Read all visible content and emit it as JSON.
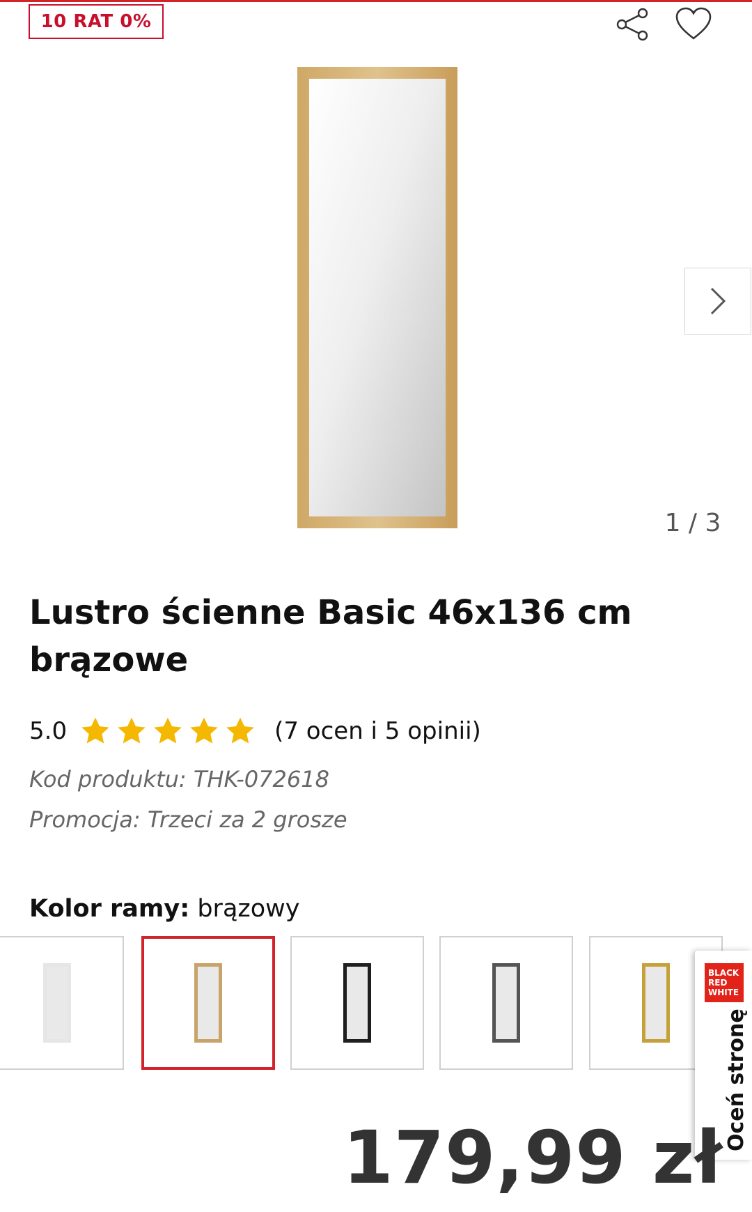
{
  "promo_badge": "10 RAT 0%",
  "icons": {
    "share": "share-icon",
    "favorite": "heart-icon",
    "next": "chevron-right-icon"
  },
  "gallery": {
    "current": "1",
    "separator": "/",
    "total": "3"
  },
  "product": {
    "title": "Lustro ścienne Basic 46x136 cm brązowe",
    "rating_value": "5.0",
    "rating_stars": 5,
    "rating_count": "(7 ocen i 5 opinii)",
    "code": "Kod produktu: THK-072618",
    "promotion": "Promocja: Trzeci za 2 grosze",
    "color_label": "Kolor ramy:",
    "color_value": "brązowy",
    "price": "179,99 zł"
  },
  "swatches": [
    {
      "name": "biały",
      "frame": "#e6e6e6",
      "selected": false
    },
    {
      "name": "brązowy",
      "frame": "#c9a46a",
      "selected": true
    },
    {
      "name": "czarny",
      "frame": "#1f1f1f",
      "selected": false
    },
    {
      "name": "szary",
      "frame": "#555555",
      "selected": false
    },
    {
      "name": "złoty",
      "frame": "#c6a13a",
      "selected": false
    }
  ],
  "feedback_tab": {
    "brand_lines": [
      "BLACK",
      "RED",
      "WHITE"
    ],
    "label": "Oceń stronę"
  },
  "colors": {
    "accent": "#d2232a",
    "star": "#f5b800",
    "wood": "#d6b57c"
  }
}
